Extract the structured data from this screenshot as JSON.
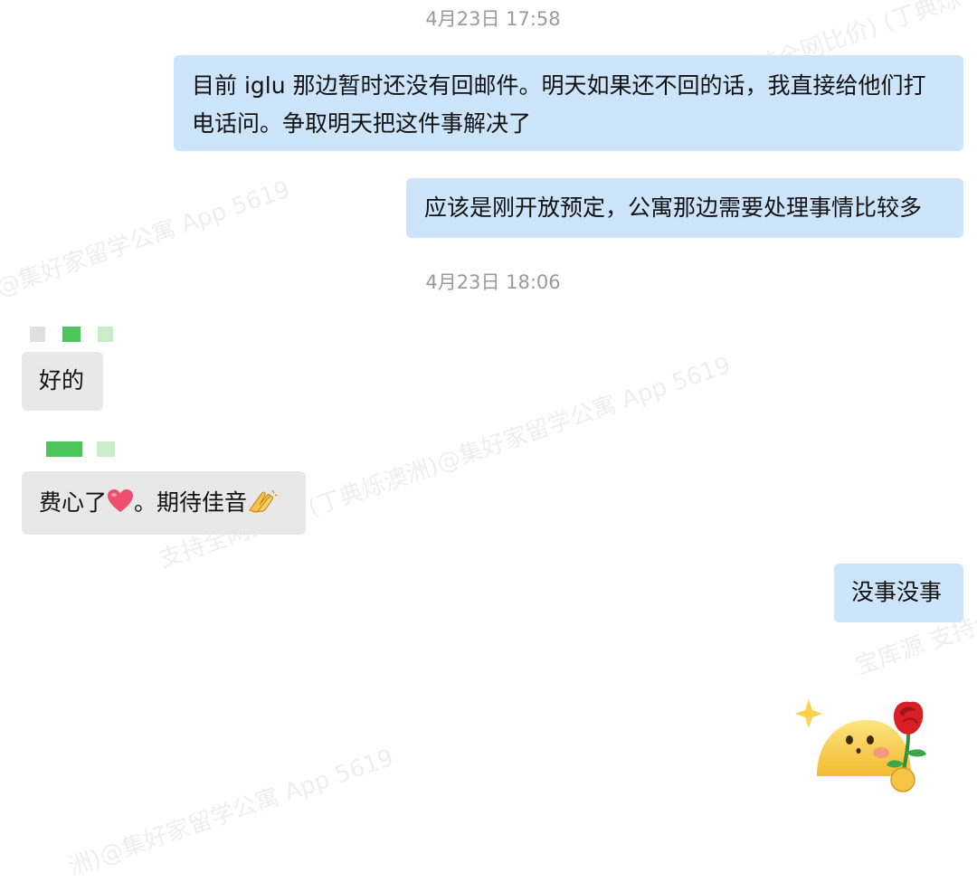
{
  "watermarks": [
    "@集好家留学公寓 App 5619",
    "支持全网比价) (丁典烁澳洲)@集好家留学公寓 App 5619",
    "洲)@集好家留学公寓 App 5619",
    "持全网比价) (丁典烁",
    "宝库源 支持全"
  ],
  "messages": [
    {
      "type": "timestamp",
      "text": "4月23日 17:58"
    },
    {
      "type": "outgoing",
      "text": "目前 iglu 那边暂时还没有回邮件。明天如果还不回的话，我直接给他们打电话问。争取明天把这件事解决了"
    },
    {
      "type": "outgoing",
      "text": "应该是刚开放预定，公寓那边需要处理事情比较多"
    },
    {
      "type": "timestamp",
      "text": "4月23日 18:06"
    },
    {
      "type": "incoming",
      "text": "好的"
    },
    {
      "type": "incoming",
      "text_before": "费心了",
      "text_middle": "。期待佳音",
      "emoji_1": "heart-emoji",
      "emoji_2": "clap-hands-emoji"
    },
    {
      "type": "outgoing",
      "text": "没事没事"
    },
    {
      "type": "sticker",
      "name": "smiling-face-with-rose-sticker"
    }
  ],
  "colors": {
    "outgoing_bubble": "#cde5fb",
    "incoming_bubble": "#e8e8e8",
    "timestamp": "#9a9a9a",
    "name_blur": "#4cc65a"
  }
}
